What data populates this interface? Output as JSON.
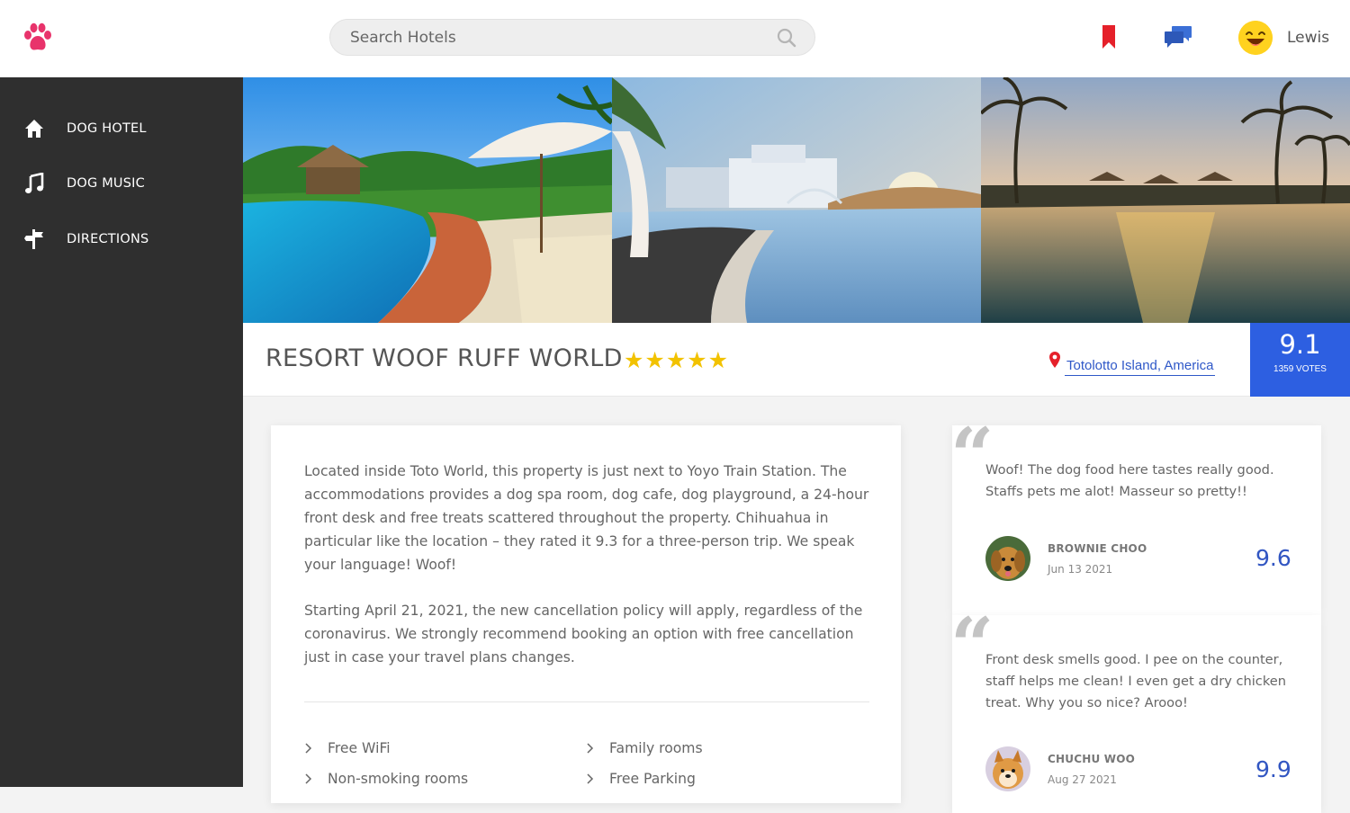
{
  "header": {
    "logo_icon": "paw-icon",
    "search_placeholder": "Search Hotels",
    "bookmark_icon": "bookmark-icon",
    "chat_icon": "chat-icon",
    "username": "Lewis",
    "brand_color": "#e8336b"
  },
  "sidebar": {
    "items": [
      {
        "label": "DOG HOTEL",
        "icon": "home-icon"
      },
      {
        "label": "DOG MUSIC",
        "icon": "music-icon"
      },
      {
        "label": "DIRECTIONS",
        "icon": "signpost-icon"
      }
    ]
  },
  "hotel": {
    "name": "RESORT WOOF RUFF WORLD",
    "stars": "★★★★★",
    "location": "Totolotto Island, America",
    "score": "9.1",
    "votes": "1359 VOTES"
  },
  "description": {
    "p1": "Located inside Toto World, this property is just next to Yoyo Train Station. The accommodations provides a dog spa room, dog cafe, dog playground, a 24-hour front desk and free treats scattered throughout the property. Chihuahua in particular like the location – they rated it 9.3 for a three-person trip. We speak your language! Woof!",
    "p2": "Starting April 21, 2021, the new cancellation policy will apply, regardless of the coronavirus. We strongly recommend booking an option with free cancellation just in case your travel plans changes.",
    "amenities": [
      "Free WiFi",
      "Family rooms",
      "Non-smoking rooms",
      "Free Parking"
    ]
  },
  "reviews": [
    {
      "text": "Woof! The dog food here tastes really good. Staffs pets me alot! Masseur so pretty!!",
      "name": "BROWNIE CHOO",
      "date": "Jun 13 2021",
      "score": "9.6"
    },
    {
      "text": "Front desk smells good. I pee on the counter, staff helps me clean! I even get a dry chicken treat. Why you so nice? Arooo!",
      "name": "CHUCHU WOO",
      "date": "Aug 27 2021",
      "score": "9.9"
    }
  ]
}
